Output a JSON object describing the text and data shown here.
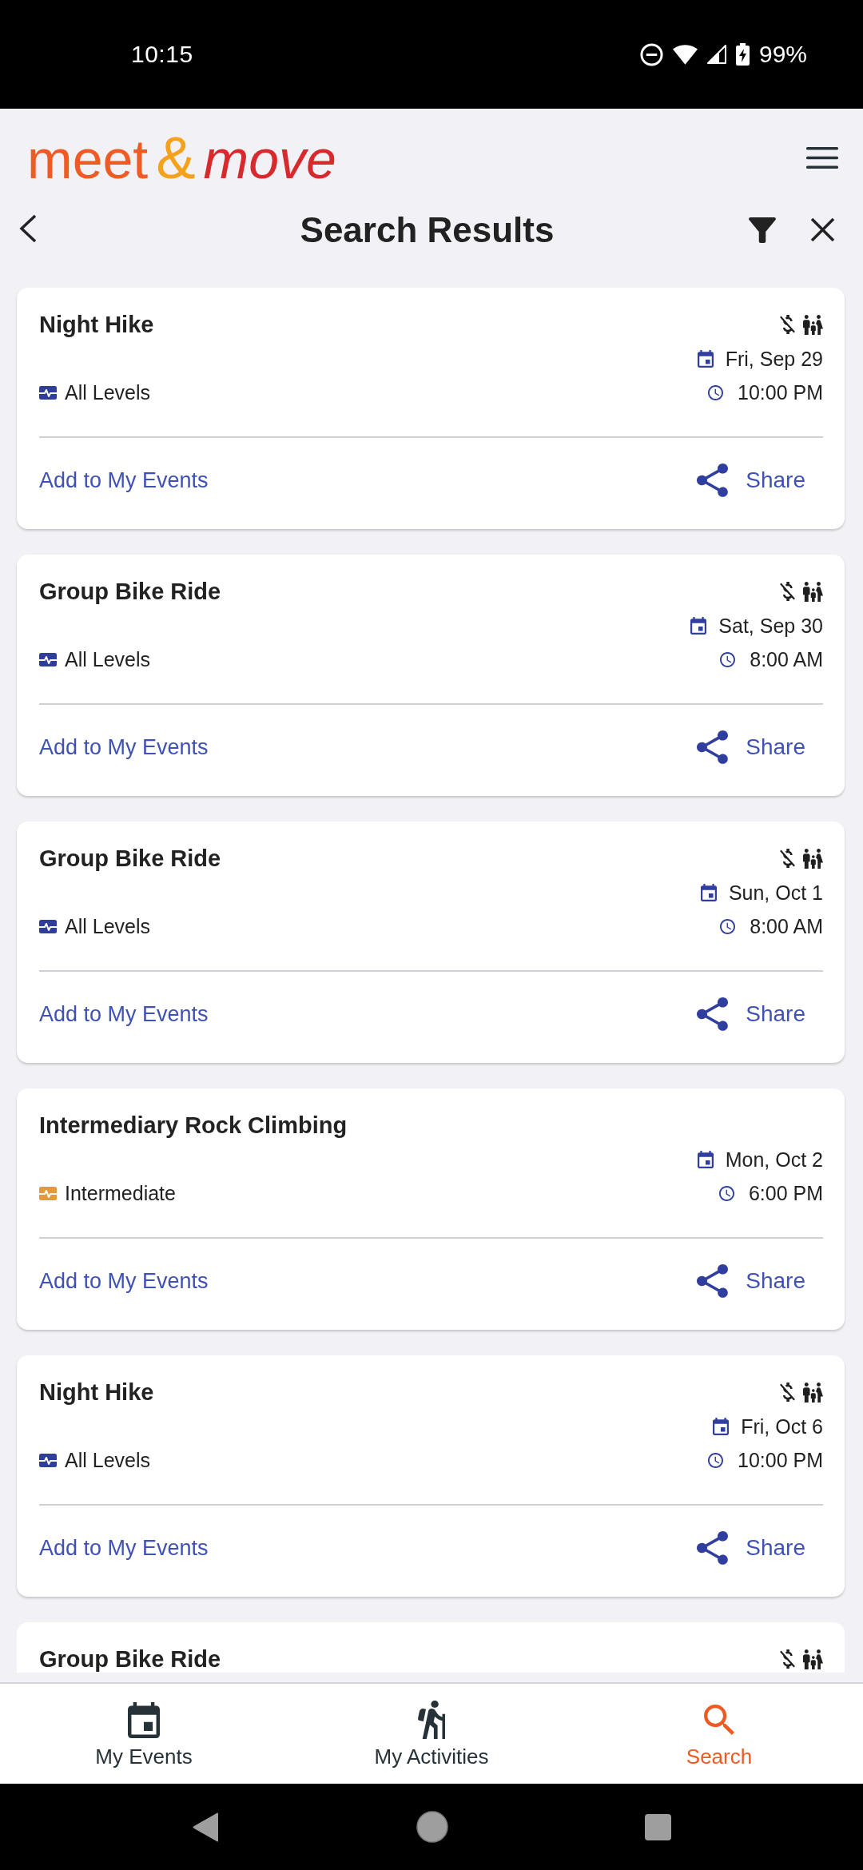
{
  "status_bar": {
    "time": "10:15",
    "battery": "99%"
  },
  "app_bar": {
    "logo": {
      "first_word": "meet",
      "ampersand": "&",
      "second_word": "move"
    },
    "title": "Search Results"
  },
  "events": [
    {
      "title": "Night Hike",
      "free": true,
      "family_friendly": true,
      "date": "Fri, Sep 29",
      "time": "10:00 PM",
      "difficulty": {
        "label": "All Levels",
        "color": "#2f3d9b"
      },
      "add_action": "Add to My Events",
      "share_action": "Share"
    },
    {
      "title": "Group Bike Ride",
      "free": true,
      "family_friendly": true,
      "date": "Sat, Sep 30",
      "time": "8:00 AM",
      "difficulty": {
        "label": "All Levels",
        "color": "#2f3d9b"
      },
      "add_action": "Add to My Events",
      "share_action": "Share"
    },
    {
      "title": "Group Bike Ride",
      "free": true,
      "family_friendly": true,
      "date": "Sun, Oct 1",
      "time": "8:00 AM",
      "difficulty": {
        "label": "All Levels",
        "color": "#2f3d9b"
      },
      "add_action": "Add to My Events",
      "share_action": "Share"
    },
    {
      "title": "Intermediary Rock Climbing",
      "free": false,
      "family_friendly": false,
      "date": "Mon, Oct 2",
      "time": "6:00 PM",
      "difficulty": {
        "label": "Intermediate",
        "color": "#e59a3a"
      },
      "add_action": "Add to My Events",
      "share_action": "Share"
    },
    {
      "title": "Night Hike",
      "free": true,
      "family_friendly": true,
      "date": "Fri, Oct 6",
      "time": "10:00 PM",
      "difficulty": {
        "label": "All Levels",
        "color": "#2f3d9b"
      },
      "add_action": "Add to My Events",
      "share_action": "Share"
    },
    {
      "title": "Group Bike Ride",
      "free": true,
      "family_friendly": true
    }
  ],
  "bottom_nav": [
    {
      "label": "My Events",
      "selected": false
    },
    {
      "label": "My Activities",
      "selected": false
    },
    {
      "label": "Search",
      "selected": true
    }
  ]
}
